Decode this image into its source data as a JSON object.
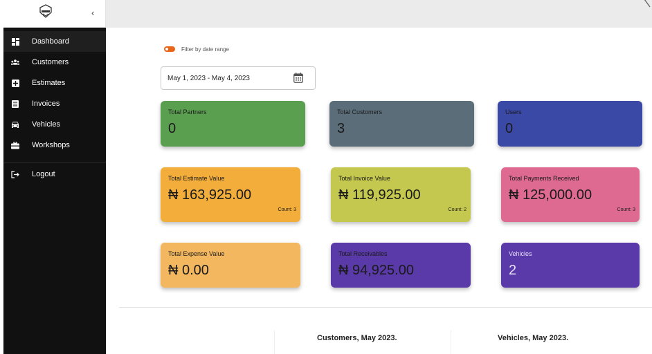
{
  "sidebar": {
    "collapse_glyph": "‹",
    "items": [
      {
        "label": "Dashboard",
        "icon": "dashboard-icon",
        "active": true
      },
      {
        "label": "Customers",
        "icon": "customers-icon"
      },
      {
        "label": "Estimates",
        "icon": "estimates-icon"
      },
      {
        "label": "Invoices",
        "icon": "invoices-icon"
      },
      {
        "label": "Vehicles",
        "icon": "car-icon"
      },
      {
        "label": "Workshops",
        "icon": "workshop-icon"
      }
    ],
    "logout_label": "Logout"
  },
  "filter": {
    "toggle_label": "Filter by date range",
    "date_range": "May 1, 2023 - May 4, 2023"
  },
  "cards": {
    "partners": {
      "label": "Total Partners",
      "value": "0",
      "color": "#5a9e50"
    },
    "customers": {
      "label": "Total Customers",
      "value": "3",
      "color": "#5b6d79"
    },
    "users": {
      "label": "Users",
      "value": "0",
      "color": "#3a48a6"
    },
    "estimate": {
      "label": "Total Estimate Value",
      "value": "₦ 163,925.00",
      "count": "Count: 3",
      "color": "#f2ad3b"
    },
    "invoice": {
      "label": "Total Invoice Value",
      "value": "₦ 119,925.00",
      "count": "Count: 2",
      "color": "#c5c84e"
    },
    "payments": {
      "label": "Total Payments Received",
      "value": "₦ 125,000.00",
      "count": "Count: 3",
      "color": "#de6a92"
    },
    "expense": {
      "label": "Total Expense Value",
      "value": "₦ 0.00",
      "color": "#f2b75f"
    },
    "receivables": {
      "label": "Total Receivables",
      "value": "₦ 94,925.00",
      "color": "#5a3aa8"
    },
    "vehicles": {
      "label": "Vehicles",
      "value": "2",
      "color": "#5a3aa8"
    }
  },
  "charts": {
    "customers_title": "Customers, May 2023.",
    "vehicles_title": "Vehicles, May 2023."
  }
}
